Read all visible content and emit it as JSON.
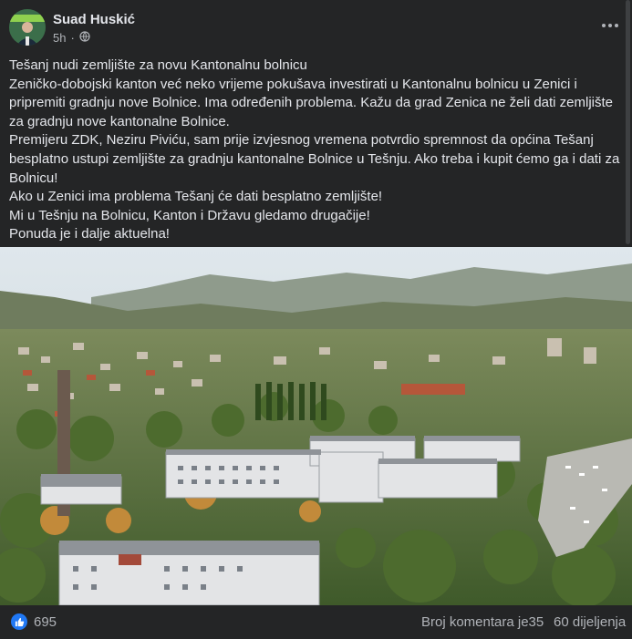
{
  "post": {
    "author": "Suad Huskić",
    "time": "5h",
    "privacy_icon": "globe-icon",
    "more_icon": "more-options-icon",
    "text_lines": [
      "Tešanj nudi zemljište za novu Kantonalnu bolnicu",
      "Zeničko-dobojski kanton već neko vrijeme pokušava investirati u Kantonalnu bolnicu u Zenici i",
      "pripremiti gradnju nove Bolnice. Ima određenih problema. Kažu da grad Zenica ne želi dati zemljište",
      "za gradnju nove kantonalne Bolnice.",
      "Premijeru ZDK, Neziru Piviću, sam prije izvjesnog vremena potvrdio spremnost da općina Tešanj",
      "besplatno ustupi zemljište za gradnju kantonalne Bolnice u Tešnju. Ako treba i kupit ćemo ga i dati za",
      "Bolnicu!",
      "Ako u Zenici ima problema Tešanj će dati besplatno zemljište!",
      "Mi u Tešnju na Bolnicu, Kanton i Državu gledamo drugačije!",
      "Ponuda je i dalje aktuelna!"
    ]
  },
  "footer": {
    "like_icon": "thumbs-up-icon",
    "like_count": "695",
    "comments": "Broj komentara je35",
    "shares": "60 dijeljenja"
  },
  "colors": {
    "background": "#242526",
    "text": "#e4e6eb",
    "secondary_text": "#b0b3b8",
    "like_blue": "#2078f4"
  }
}
